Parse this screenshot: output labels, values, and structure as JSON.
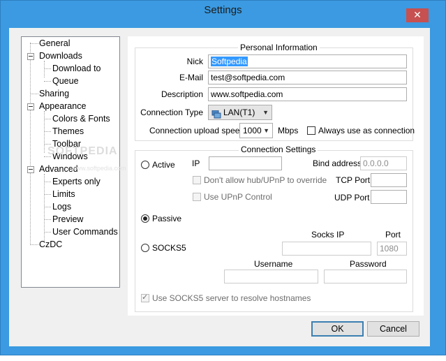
{
  "window": {
    "title": "Settings",
    "close_glyph": "✕"
  },
  "tree": {
    "items": [
      {
        "label": "General"
      },
      {
        "label": "Downloads"
      },
      {
        "label": "Download to"
      },
      {
        "label": "Queue"
      },
      {
        "label": "Sharing"
      },
      {
        "label": "Appearance"
      },
      {
        "label": "Colors & Fonts"
      },
      {
        "label": "Themes"
      },
      {
        "label": "Toolbar"
      },
      {
        "label": "Windows"
      },
      {
        "label": "Advanced"
      },
      {
        "label": "Experts only"
      },
      {
        "label": "Limits"
      },
      {
        "label": "Logs"
      },
      {
        "label": "Preview"
      },
      {
        "label": "User Commands"
      },
      {
        "label": "CzDC"
      }
    ]
  },
  "watermark": {
    "text": "SOFTPEDIA",
    "subtext": "www.softpedia.com"
  },
  "personal": {
    "title": "Personal Information",
    "nick_label": "Nick",
    "nick_value": "Softpedia",
    "email_label": "E-Mail",
    "email_value": "test@softpedia.com",
    "description_label": "Description",
    "description_value": "www.softpedia.com",
    "connection_type_label": "Connection Type",
    "connection_type_value": "LAN(T1)",
    "upload_speed_label": "Connection upload speed",
    "upload_speed_value": "1000",
    "upload_speed_unit": "Mbps",
    "always_use_label": "Always use as connection"
  },
  "connection": {
    "title": "Connection Settings",
    "active_label": "Active",
    "ip_label": "IP",
    "bind_label": "Bind address",
    "bind_value": "0.0.0.0",
    "no_hub_upnp_label": "Don't allow hub/UPnP to override",
    "use_upnp_label": "Use UPnP Control",
    "tcp_label": "TCP Port",
    "udp_label": "UDP Port",
    "passive_label": "Passive",
    "socks5_label": "SOCKS5",
    "socks_ip_label": "Socks IP",
    "port_label": "Port",
    "port_value": "1080",
    "username_label": "Username",
    "password_label": "Password",
    "resolve_label": "Use SOCKS5 server to resolve hostnames"
  },
  "buttons": {
    "ok": "OK",
    "cancel": "Cancel"
  }
}
